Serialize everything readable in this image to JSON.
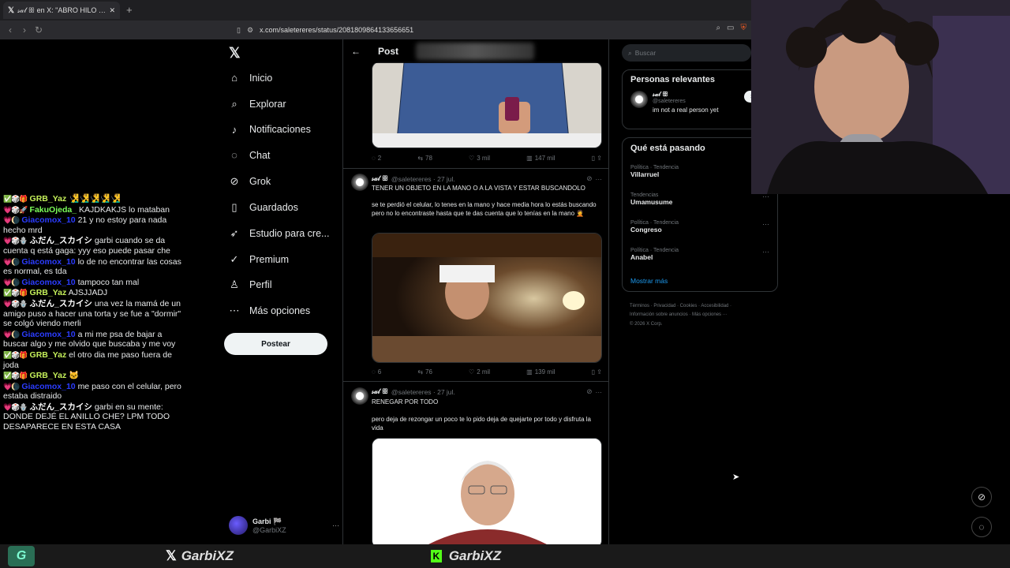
{
  "browser": {
    "tab_title": "𝓈𝒶𝓁 ꕥ en X: \"ABRO HILO DE TO...",
    "url": "x.com/saletereres/status/2081809864133656651"
  },
  "x": {
    "logo": "𝕏",
    "nav": [
      {
        "label": "Inicio",
        "icon": "home-icon",
        "glyph": "⌂"
      },
      {
        "label": "Explorar",
        "icon": "search-icon",
        "glyph": "⌕"
      },
      {
        "label": "Notificaciones",
        "icon": "bell-icon",
        "glyph": "♪"
      },
      {
        "label": "Chat",
        "icon": "chat-icon",
        "glyph": "◌"
      },
      {
        "label": "Grok",
        "icon": "grok-icon",
        "glyph": "⊘"
      },
      {
        "label": "Guardados",
        "icon": "bookmark-icon",
        "glyph": "▯"
      },
      {
        "label": "Estudio para cre...",
        "icon": "rocket-icon",
        "glyph": "➶"
      },
      {
        "label": "Premium",
        "icon": "premium-icon",
        "glyph": "✓"
      },
      {
        "label": "Perfil",
        "icon": "profile-icon",
        "glyph": "♙"
      },
      {
        "label": "Más opciones",
        "icon": "more-icon",
        "glyph": "⋯"
      }
    ],
    "post_button": "Postear",
    "account": {
      "name": "Garbi 🏁",
      "handle": "@GarbiXZ"
    },
    "column_title": "Post",
    "tweets": [
      {
        "actions": {
          "replies": "2",
          "reposts": "78",
          "likes": "3 mil",
          "views": "147 mil"
        }
      },
      {
        "name": "𝓈𝒶𝓁 ꕥ",
        "handle": "@saletereres · 27 jul.",
        "headline": "TENER UN OBJETO EN LA MANO O A LA VISTA Y ESTAR BUSCANDOLO",
        "body": "se te perdió el celular, lo tenes en la mano y hace media hora lo estás buscando pero no lo encontraste hasta que te das cuenta que lo tenías en la mano 🤦",
        "actions": {
          "replies": "6",
          "reposts": "76",
          "likes": "2 mil",
          "views": "139 mil"
        }
      },
      {
        "name": "𝓈𝒶𝓁 ꕥ",
        "handle": "@saletereres · 27 jul.",
        "headline": "RENEGAR POR TODO",
        "body": "pero deja de rezongar un poco te lo pido deja de quejarte por todo y disfruta la vida"
      }
    ],
    "search_placeholder": "Buscar",
    "relevant": {
      "title": "Personas relevantes",
      "name": "𝓈𝒶𝓁 ꕥ",
      "handle": "@saletereres",
      "bio": "im not a real person yet",
      "follow": "Se"
    },
    "trends": {
      "title": "Qué está pasando",
      "items": [
        {
          "cat": "Política · Tendencia",
          "name": "Villarruel"
        },
        {
          "cat": "Tendencias",
          "name": "Umamusume"
        },
        {
          "cat": "Política · Tendencia",
          "name": "Congreso"
        },
        {
          "cat": "Política · Tendencia",
          "name": "Anabel"
        }
      ],
      "more": "Mostrar más"
    },
    "footer": {
      "l1": "Términos · Privacidad · Cookies · Accesibilidad ·",
      "l2": "Información sobre anuncios · Más opciones ···",
      "l3": "© 2026 X Corp."
    }
  },
  "chat": [
    {
      "badges": "✅🎲🎁",
      "user": "GRB_Yaz",
      "color": "#c5f05a",
      "msg": "🧏‍♂️🧏‍♂️🧏‍♂️🧏‍♂️🧏‍♂️"
    },
    {
      "badges": "💗🎲🚀",
      "user": "FakuOjeda_",
      "color": "#7cff5a",
      "msg": "KAJDKAKJS lo mataban"
    },
    {
      "badges": "💗🌘",
      "user": "Giacomox_10",
      "color": "#2b3cff",
      "msg": "21 y no estoy para nada hecho mrd"
    },
    {
      "badges": "💗🎲🪬",
      "user": "ふだん_スカイシ",
      "color": "#ffffff",
      "msg": "garbi cuando se da cuenta q está gaga: yyy eso puede pasar che"
    },
    {
      "badges": "💗🌘",
      "user": "Giacomox_10",
      "color": "#2b3cff",
      "msg": "lo de no encontrar las cosas es normal, es tda"
    },
    {
      "badges": "💗🌘",
      "user": "Giacomox_10",
      "color": "#2b3cff",
      "msg": "tampoco tan mal"
    },
    {
      "badges": "✅🎲🎁",
      "user": "GRB_Yaz",
      "color": "#c5f05a",
      "msg": "AJSJJADJ"
    },
    {
      "badges": "💗🎲🪬",
      "user": "ふだん_スカイシ",
      "color": "#ffffff",
      "msg": "una vez la mamá de un amigo puso a hacer una torta y se fue a \"dormir\" se colgó viendo merli"
    },
    {
      "badges": "💗🌘",
      "user": "Giacomox_10",
      "color": "#2b3cff",
      "msg": "a mi me psa de bajar a buscar algo y me olvido que buscaba y me voy"
    },
    {
      "badges": "✅🎲🎁",
      "user": "GRB_Yaz",
      "color": "#c5f05a",
      "msg": "el otro dia me paso fuera de joda"
    },
    {
      "badges": "✅🎲🎁",
      "user": "GRB_Yaz",
      "color": "#c5f05a",
      "msg": "🐱"
    },
    {
      "badges": "💗🌘",
      "user": "Giacomox_10",
      "color": "#2b3cff",
      "msg": "me paso con el celular, pero estaba distraido"
    },
    {
      "badges": "💗🎲🪬",
      "user": "ふだん_スカイシ",
      "color": "#ffffff",
      "msg": "garbi en su mente: DONDE DEJÉ EL ANILLO CHE? LPM TODO DESAPARECE EN ESTA CASA"
    }
  ],
  "overlay": {
    "x_handle": "GarbiXZ",
    "kick_handle": "GarbiXZ"
  },
  "colors": {
    "x_blue": "#1d9bf0",
    "kick_green": "#53fc18"
  }
}
